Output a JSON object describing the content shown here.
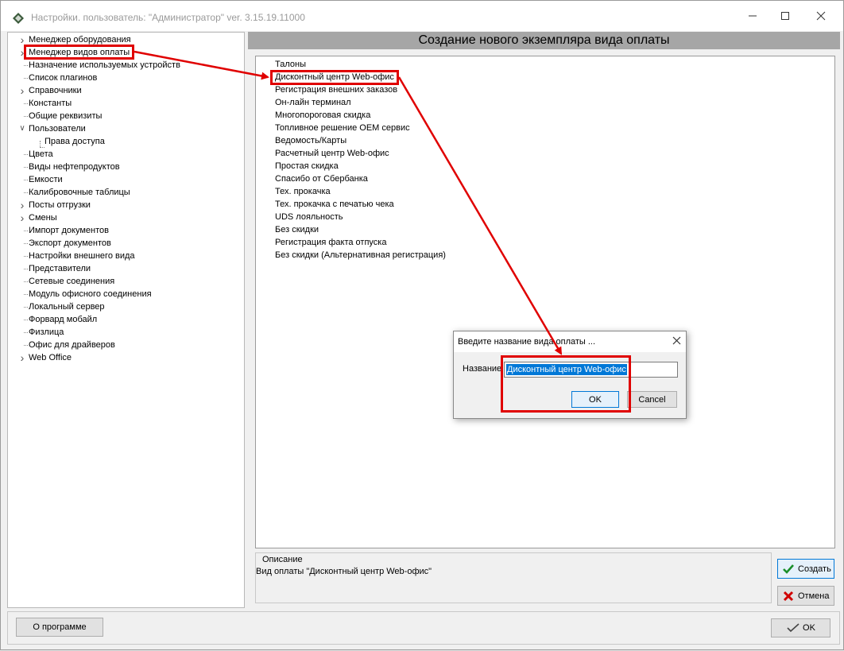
{
  "window": {
    "title": "Настройки. пользователь: \"Администратор\" ver. 3.15.19.11000",
    "min_icon": "minimize-icon",
    "max_icon": "maximize-icon",
    "close_icon": "close-icon"
  },
  "tree": {
    "items": [
      {
        "label": "Менеджер оборудования",
        "expander": true
      },
      {
        "label": "Менеджер видов оплаты",
        "expander": true,
        "selected": true
      },
      {
        "label": "Назначение используемых устройств",
        "expander": false
      },
      {
        "label": "Список плагинов",
        "expander": false
      },
      {
        "label": "Справочники",
        "expander": true
      },
      {
        "label": "Константы",
        "expander": false
      },
      {
        "label": "Общие реквизиты",
        "expander": false
      },
      {
        "label": "Пользователи",
        "expander": true,
        "expanded": true
      },
      {
        "label": "Права доступа",
        "child": true
      },
      {
        "label": "Цвета",
        "expander": false
      },
      {
        "label": "Виды нефтепродуктов",
        "expander": false
      },
      {
        "label": "Емкости",
        "expander": false
      },
      {
        "label": "Калибровочные таблицы",
        "expander": false
      },
      {
        "label": "Посты отгрузки",
        "expander": true
      },
      {
        "label": "Смены",
        "expander": true
      },
      {
        "label": "Импорт документов",
        "expander": false
      },
      {
        "label": "Экспорт документов",
        "expander": false
      },
      {
        "label": "Настройки внешнего вида",
        "expander": false
      },
      {
        "label": "Представители",
        "expander": false
      },
      {
        "label": "Сетевые соединения",
        "expander": false
      },
      {
        "label": "Модуль офисного соединения",
        "expander": false
      },
      {
        "label": "Локальный сервер",
        "expander": false
      },
      {
        "label": "Форвард мобайл",
        "expander": false
      },
      {
        "label": "Физлица",
        "expander": false
      },
      {
        "label": "Офис для драйверов",
        "expander": false
      },
      {
        "label": "Web Office",
        "expander": true
      }
    ]
  },
  "main": {
    "header": "Создание нового экземпляра вида оплаты",
    "payment_types": [
      "Талоны",
      "Дисконтный центр Web-офис",
      "Регистрация внешних заказов",
      "Он-лайн терминал",
      "Многопороговая скидка",
      "Топливное решение OEM сервис",
      "Ведомость/Карты",
      "Расчетный центр Web-офис",
      "Простая скидка",
      "Спасибо от Сбербанка",
      "Тех. прокачка",
      "Тех. прокачка с печатью чека",
      "UDS лояльность",
      "Без скидки",
      "Регистрация факта отпуска",
      "Без скидки (Альтернативная регистрация)"
    ],
    "description_title": "Описание",
    "description_text": "Вид оплаты \"Дисконтный центр Web-офис\"",
    "create_label": "Создать",
    "cancel_label": "Отмена"
  },
  "footer": {
    "about_label": "О программе",
    "ok_label": "OK"
  },
  "dialog": {
    "title": "Введите название вида оплаты ...",
    "name_label": "Название",
    "name_value": "Дисконтный центр Web-офис",
    "ok_label": "OK",
    "cancel_label": "Cancel"
  },
  "colors": {
    "highlight": "#e00000",
    "selection": "#0078d7",
    "header_bg": "#a6a6a6",
    "create_check": "#1a8f2a",
    "cancel_x": "#d00000"
  }
}
